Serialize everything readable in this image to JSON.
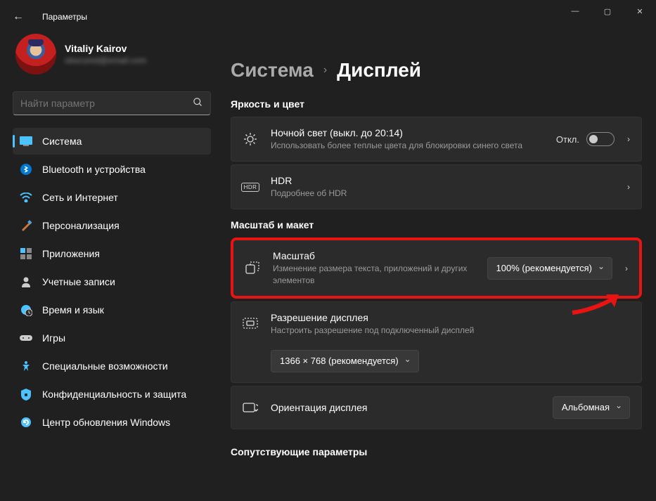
{
  "window": {
    "title": "Параметры"
  },
  "user": {
    "name": "Vitaliy Kairov",
    "email": "obscured@email.com"
  },
  "search": {
    "placeholder": "Найти параметр"
  },
  "nav": {
    "system": "Система",
    "bluetooth": "Bluetooth и устройства",
    "network": "Сеть и Интернет",
    "personalization": "Персонализация",
    "apps": "Приложения",
    "accounts": "Учетные записи",
    "time": "Время и язык",
    "gaming": "Игры",
    "accessibility": "Специальные возможности",
    "privacy": "Конфиденциальность и защита",
    "update": "Центр обновления Windows"
  },
  "breadcrumb": {
    "parent": "Система",
    "current": "Дисплей"
  },
  "sections": {
    "brightness": "Яркость и цвет",
    "scale": "Масштаб и макет",
    "related": "Сопутствующие параметры"
  },
  "nightlight": {
    "title": "Ночной свет (выкл. до 20:14)",
    "desc": "Использовать более теплые цвета для блокировки синего света",
    "state": "Откл."
  },
  "hdr": {
    "title": "HDR",
    "link": "Подробнее об HDR"
  },
  "scale": {
    "title": "Масштаб",
    "desc": "Изменение размера текста, приложений и других элементов",
    "value": "100% (рекомендуется)"
  },
  "resolution": {
    "title": "Разрешение дисплея",
    "desc": "Настроить разрешение под подключенный дисплей",
    "value": "1366 × 768 (рекомендуется)"
  },
  "orientation": {
    "title": "Ориентация дисплея",
    "value": "Альбомная"
  }
}
